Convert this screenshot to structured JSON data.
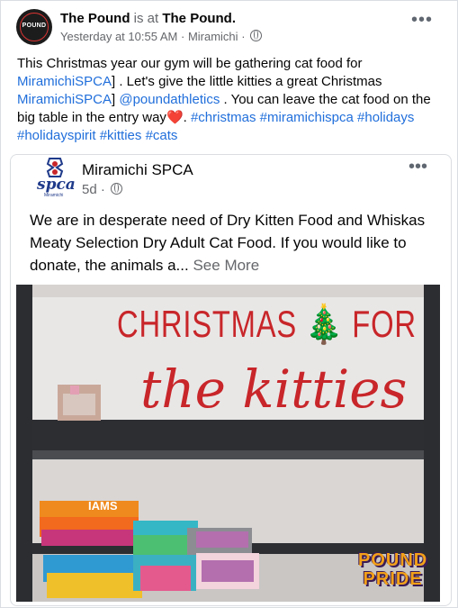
{
  "post": {
    "author": "The Pound",
    "is_at": "is at",
    "place": "The Pound.",
    "timestamp": "Yesterday at 10:55 AM",
    "location": "Miramichi",
    "dot": "·",
    "more": "•••",
    "avatar_text": "POUND",
    "text_1": "This Christmas year our gym will be gathering cat food for",
    "mention_1": "MiramichiSPCA",
    "text_2": "] . Let's give the little kitties a great Christmas",
    "mention_2": "MiramichiSPCA",
    "text_3": "]",
    "mention_3": "@poundathletics",
    "text_4": ". You can leave the cat food on the big table in the entry way",
    "heart": "❤️",
    "hashtags": "#christmas #miramichispca #holidays #holidayspirit #kitties #cats"
  },
  "shared": {
    "logo_text": "spca",
    "logo_subtext": "Miramichi",
    "page_name": "Miramichi SPCA",
    "age": "5d",
    "dot": "·",
    "more": "•••",
    "text": "We are in desperate need of Dry Kitten Food and Whiskas Meaty Selection Dry Adult Cat Food. If you would like to donate, the animals a...",
    "see_more": "See More",
    "photo": {
      "title_line1": "CHRISTMAS 🎄 FOR",
      "title_line2": "the kitties",
      "badge_line1": "POUND",
      "badge_line2": "PRIDE",
      "bag_label": "IAMS"
    }
  }
}
